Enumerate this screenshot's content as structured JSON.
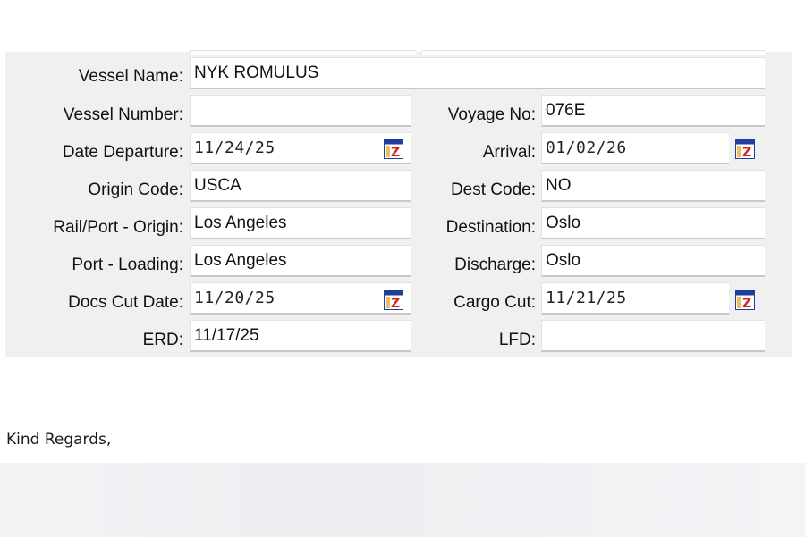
{
  "form": {
    "vessel_name": {
      "label": "Vessel Name:",
      "value": "NYK ROMULUS"
    },
    "vessel_number": {
      "label": "Vessel Number:",
      "value": ""
    },
    "voyage_no": {
      "label": "Voyage No:",
      "value": "076E"
    },
    "date_departure": {
      "label": "Date Departure:",
      "value": "11/24/25"
    },
    "arrival": {
      "label": "Arrival:",
      "value": "01/02/26"
    },
    "origin_code": {
      "label": "Origin Code:",
      "value": "USCA"
    },
    "dest_code": {
      "label": "Dest Code:",
      "value": "NO"
    },
    "rail_port_origin": {
      "label": "Rail/Port - Origin:",
      "value": "Los Angeles"
    },
    "destination": {
      "label": "Destination:",
      "value": "Oslo"
    },
    "port_loading": {
      "label": "Port - Loading:",
      "value": "Los Angeles"
    },
    "discharge": {
      "label": "Discharge:",
      "value": "Oslo"
    },
    "docs_cut_date": {
      "label": "Docs Cut Date:",
      "value": "11/20/25"
    },
    "cargo_cut": {
      "label": "Cargo Cut:",
      "value": "11/21/25"
    },
    "erd": {
      "label": "ERD:",
      "value": "11/17/25"
    },
    "lfd": {
      "label": "LFD:",
      "value": ""
    }
  },
  "icons": {
    "calendar": "calendar-icon"
  },
  "colors": {
    "panel": "#f0f0f0",
    "calendar_red": "#d42020",
    "calendar_blue": "#1f3f9a"
  },
  "closing": "Kind Regards,"
}
